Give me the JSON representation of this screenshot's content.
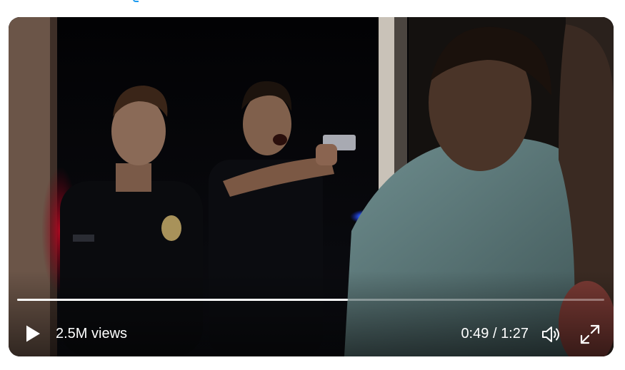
{
  "player": {
    "views_label": "2.5M views",
    "current_time": "0:49",
    "separator": "/",
    "duration": "1:27",
    "progress_fraction": 0.5632,
    "colors": {
      "link_accent": "#1d9bf0",
      "progress_played": "#ffffff",
      "progress_unplayed": "rgba(255,255,255,0.35)",
      "controls": "#ffffff"
    },
    "icons": {
      "play": "play-icon",
      "volume": "volume-icon",
      "fullscreen": "fullscreen-icon"
    }
  }
}
